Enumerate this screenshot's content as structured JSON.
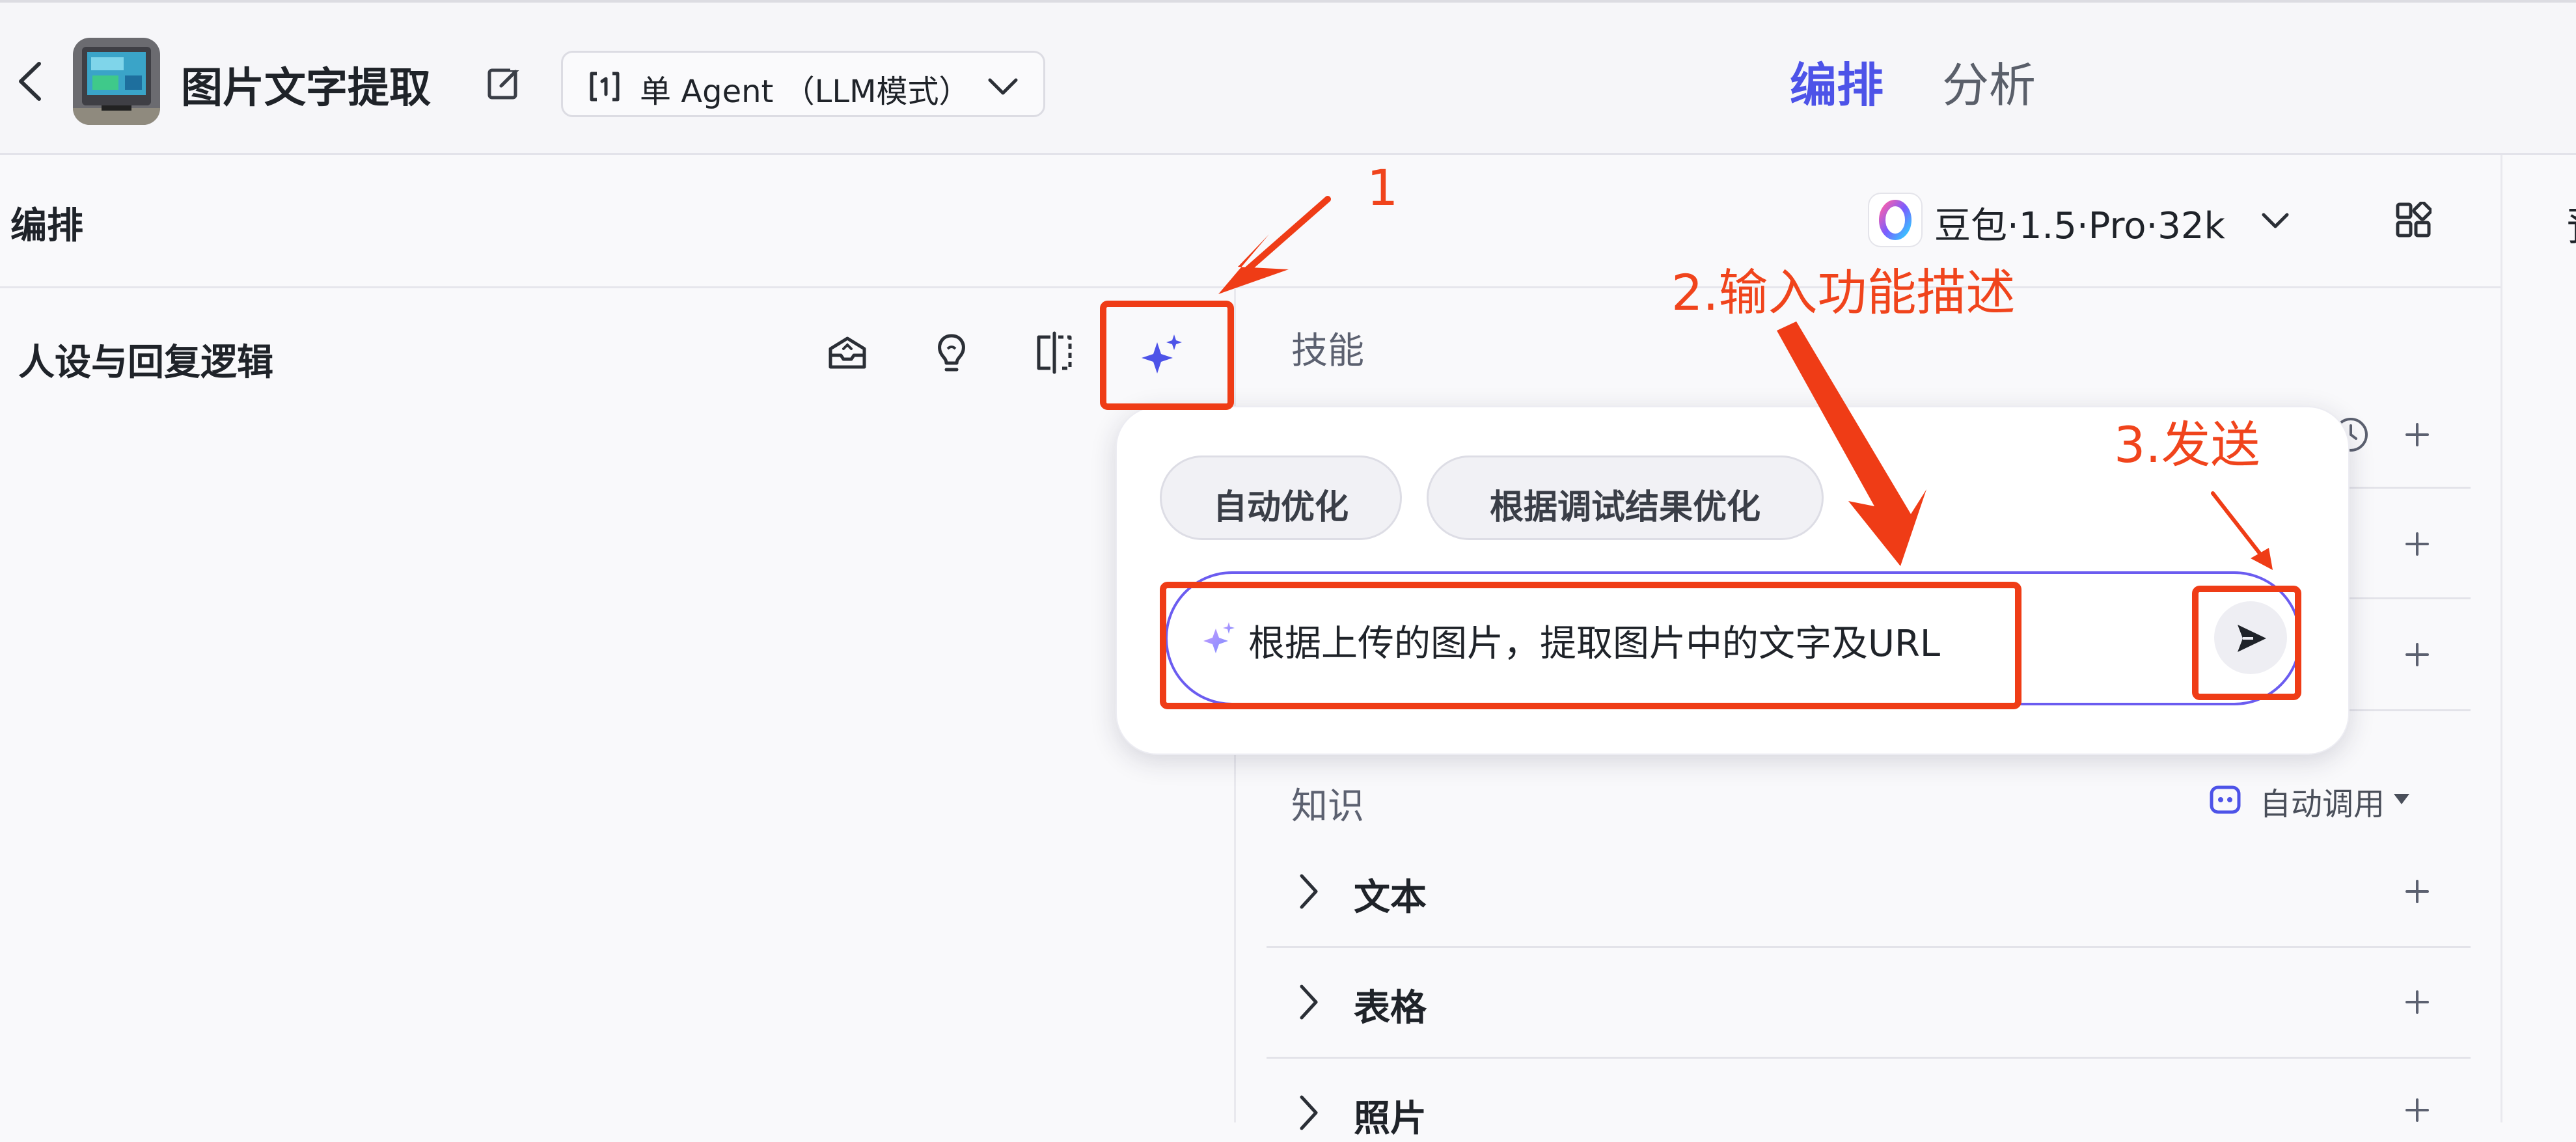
{
  "header": {
    "app_title": "图片文字提取",
    "mode_label": "单 Agent （LLM模式）",
    "tabs": [
      {
        "label": "编排",
        "active": true
      },
      {
        "label": "分析",
        "active": false
      }
    ]
  },
  "arrange": {
    "heading": "编排",
    "model_label": "豆包·1.5·Pro·32k",
    "right_edge_char": "预"
  },
  "persona": {
    "title": "人设与回复逻辑"
  },
  "skills": {
    "heading": "技能"
  },
  "knowledge": {
    "heading": "知识",
    "auto_call_label": "自动调用",
    "rows": [
      {
        "label": "文本"
      },
      {
        "label": "表格"
      },
      {
        "label": "照片"
      }
    ]
  },
  "ai_popover": {
    "chips": [
      "自动优化",
      "根据调试结果优化"
    ],
    "input_text": "根据上传的图片，提取图片中的文字及URL"
  },
  "annotations": {
    "step1": "1",
    "step2": "2.输入功能描述",
    "step3": "3.发送"
  },
  "colors": {
    "accent": "#4d53e8",
    "annotation": "#ef3c16",
    "input_border": "#6b5cf0"
  },
  "icons": [
    "back-icon",
    "edit-icon",
    "mode-icon",
    "chevron-down-icon",
    "doubao-model-icon",
    "layout-grid-icon",
    "prompt-library-icon",
    "bulb-icon",
    "compare-icon",
    "sparkle-icon",
    "history-icon",
    "plus-icon",
    "auto-call-icon",
    "chevron-right-icon",
    "send-icon"
  ]
}
